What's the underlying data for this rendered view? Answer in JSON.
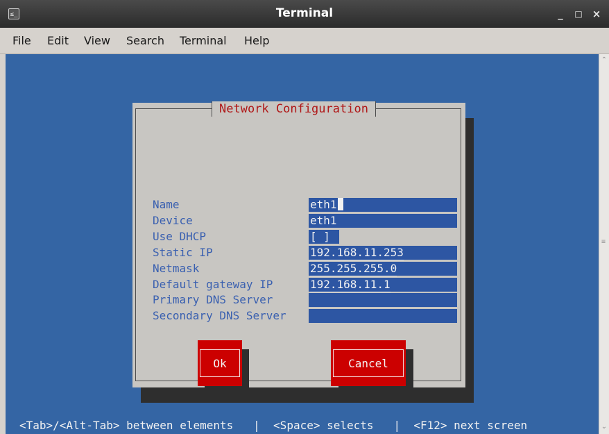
{
  "window": {
    "title": "Terminal",
    "app_icon_glyph": "≤_",
    "icons": [
      "terminal-icon",
      "minimize-icon",
      "maximize-icon",
      "close-icon"
    ]
  },
  "menubar": {
    "items": [
      {
        "label": "File"
      },
      {
        "label": "Edit"
      },
      {
        "label": "View"
      },
      {
        "label": "Search"
      },
      {
        "label": "Terminal"
      },
      {
        "label": "Help"
      }
    ]
  },
  "dialog": {
    "title": "Network Configuration",
    "fields": [
      {
        "label": "Name",
        "value": "eth1"
      },
      {
        "label": "Device",
        "value": "eth1"
      },
      {
        "label": "Use DHCP",
        "value": "[ ]"
      },
      {
        "label": "Static IP",
        "value": "192.168.11.253"
      },
      {
        "label": "Netmask",
        "value": "255.255.255.0"
      },
      {
        "label": "Default gateway IP",
        "value": "192.168.11.1"
      },
      {
        "label": "Primary DNS Server",
        "value": ""
      },
      {
        "label": "Secondary DNS Server",
        "value": ""
      }
    ],
    "ok_label": "Ok",
    "cancel_label": "Cancel"
  },
  "status_line": "<Tab>/<Alt-Tab> between elements   |  <Space> selects   |  <F12> next screen",
  "colors": {
    "terminal_bg": "#3465a4",
    "dialog_bg": "#c8c6c2",
    "accent_red": "#cc0000",
    "label_blue": "#3a60b0",
    "field_bg": "#2d56a3"
  }
}
